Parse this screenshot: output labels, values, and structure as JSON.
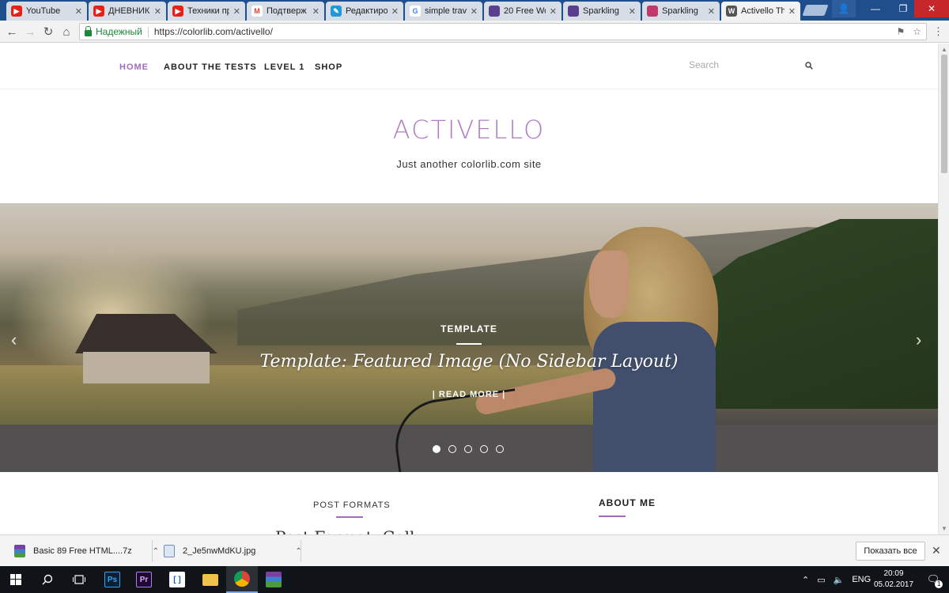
{
  "browser": {
    "tabs": [
      {
        "label": "YouTube",
        "favicon": "youtube-icon",
        "color": "#e62117",
        "active": false
      },
      {
        "label": "ДНЕВНИК",
        "favicon": "youtube-icon",
        "color": "#e62117",
        "active": false
      },
      {
        "label": "Техники пр",
        "favicon": "youtube-icon",
        "color": "#e62117",
        "active": false
      },
      {
        "label": "Подтверж",
        "favicon": "gmail-icon",
        "color": "#d44638",
        "active": false
      },
      {
        "label": "Редактиро",
        "favicon": "editor-icon",
        "color": "#1e9ad6",
        "active": false
      },
      {
        "label": "simple trav",
        "favicon": "google-icon",
        "color": "#4285f4",
        "active": false
      },
      {
        "label": "20 Free Wo",
        "favicon": "colorlib-icon",
        "color": "#5b3f8f",
        "active": false
      },
      {
        "label": "Sparkling",
        "favicon": "colorlib-icon",
        "color": "#5b3f8f",
        "active": false
      },
      {
        "label": "Sparkling",
        "favicon": "sparkling-icon",
        "color": "#c0396b",
        "active": false
      },
      {
        "label": "Activello Th",
        "favicon": "wordpress-icon",
        "color": "#555555",
        "active": true
      }
    ],
    "security_label": "Надежный",
    "url": "https://colorlib.com/activello/"
  },
  "site": {
    "nav": {
      "home": "HOME",
      "about": "ABOUT THE TESTS",
      "level1": "LEVEL 1",
      "shop": "SHOP",
      "search_placeholder": "Search"
    },
    "logo": "ACTIVELLO",
    "tagline": "Just another colorlib.com site",
    "accent_color": "#a36bbd",
    "hero": {
      "category": "TEMPLATE",
      "title": "Template: Featured Image (No Sidebar Layout)",
      "read_more": "| READ MORE |",
      "slide_count": 5,
      "active_slide": 1
    },
    "sections": {
      "post_formats": "POST FORMATS",
      "about_me": "ABOUT ME",
      "post_title_partial": "Post Format: Gall"
    }
  },
  "downloads": {
    "items": [
      {
        "name": "Basic 89 Free HTML....7z",
        "icon": "archive-icon"
      },
      {
        "name": "2_Je5nwMdKU.jpg",
        "icon": "image-file-icon"
      }
    ],
    "show_all": "Показать все"
  },
  "taskbar": {
    "apps": [
      "windows-start-icon",
      "search-icon",
      "task-view-icon",
      "photoshop-icon",
      "premiere-icon",
      "brackets-icon",
      "file-explorer-icon",
      "chrome-icon",
      "winrar-icon"
    ],
    "photoshop_label": "Ps",
    "premiere_label": "Pr",
    "language": "ENG",
    "time": "20:09",
    "date": "05.02.2017",
    "notification_count": "1"
  }
}
